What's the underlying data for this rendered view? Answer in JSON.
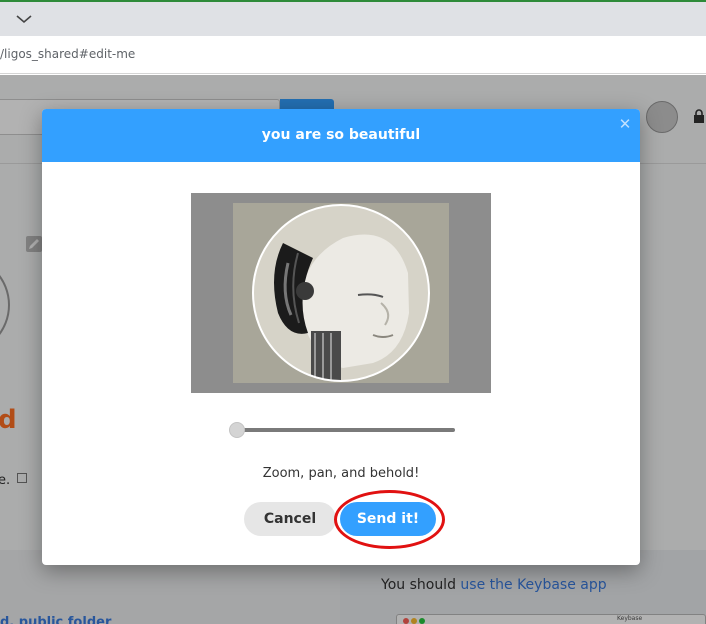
{
  "browser": {
    "url": "/ligos_shared#edit-me",
    "tab_chevron_icon": "chevron-down-icon"
  },
  "background": {
    "heading_fragment": "d",
    "text_fragment": "e.",
    "keybase_prefix": "You should ",
    "keybase_link": "use the Keybase app",
    "public_folder_fragment": "d, public folder",
    "mini_window_title": "Keybase"
  },
  "modal": {
    "title": "you are so beautiful",
    "close_icon": "close-icon",
    "hint": "Zoom, pan, and behold!",
    "zoom": 0,
    "cancel_label": "Cancel",
    "send_label": "Send it!"
  },
  "colors": {
    "accent": "#33a0ff",
    "annotation": "#e11111",
    "brand_orange": "#ff6f21"
  }
}
